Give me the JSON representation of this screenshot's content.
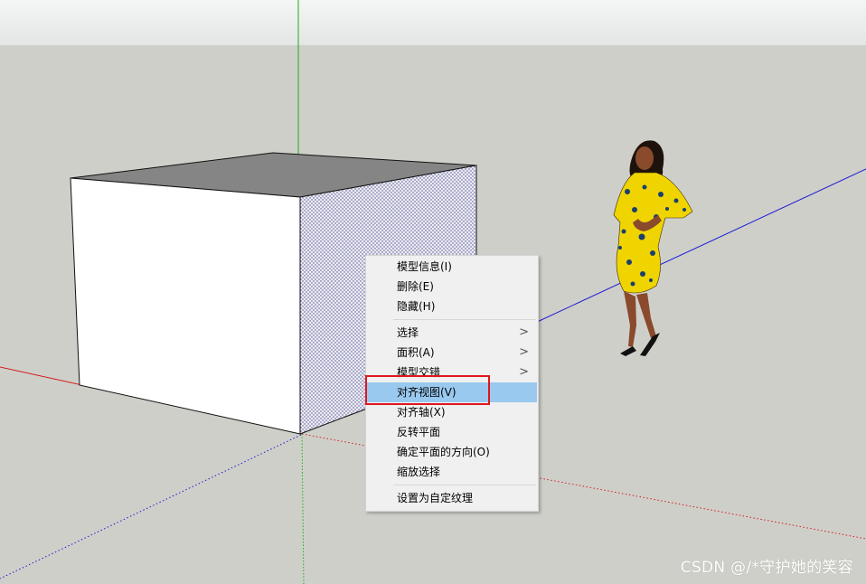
{
  "context_menu": {
    "items": [
      {
        "label": "模型信息(I)",
        "submenu": false,
        "highlighted": false
      },
      {
        "label": "删除(E)",
        "submenu": false,
        "highlighted": false
      },
      {
        "label": "隐藏(H)",
        "submenu": false,
        "highlighted": false
      },
      {
        "label": "选择",
        "submenu": true,
        "highlighted": false
      },
      {
        "label": "面积(A)",
        "submenu": true,
        "highlighted": false
      },
      {
        "label": "模型交错",
        "submenu": true,
        "highlighted": false
      },
      {
        "label": "对齐视图(V)",
        "submenu": false,
        "highlighted": true
      },
      {
        "label": "对齐轴(X)",
        "submenu": false,
        "highlighted": false
      },
      {
        "label": "反转平面",
        "submenu": false,
        "highlighted": false
      },
      {
        "label": "确定平面的方向(O)",
        "submenu": false,
        "highlighted": false
      },
      {
        "label": "缩放选择",
        "submenu": false,
        "highlighted": false
      },
      {
        "label": "设置为自定纹理",
        "submenu": false,
        "highlighted": false
      }
    ],
    "chevron": ">"
  },
  "watermark": "CSDN @/*守护她的笑容",
  "colors": {
    "sky": "#eef0f0",
    "ground": "#cfcfca",
    "axis_red": "#d21c1c",
    "axis_green": "#16b316",
    "axis_blue": "#1c1cd2",
    "highlight": "#99c9ef",
    "annotation_box": "#e0161c"
  }
}
